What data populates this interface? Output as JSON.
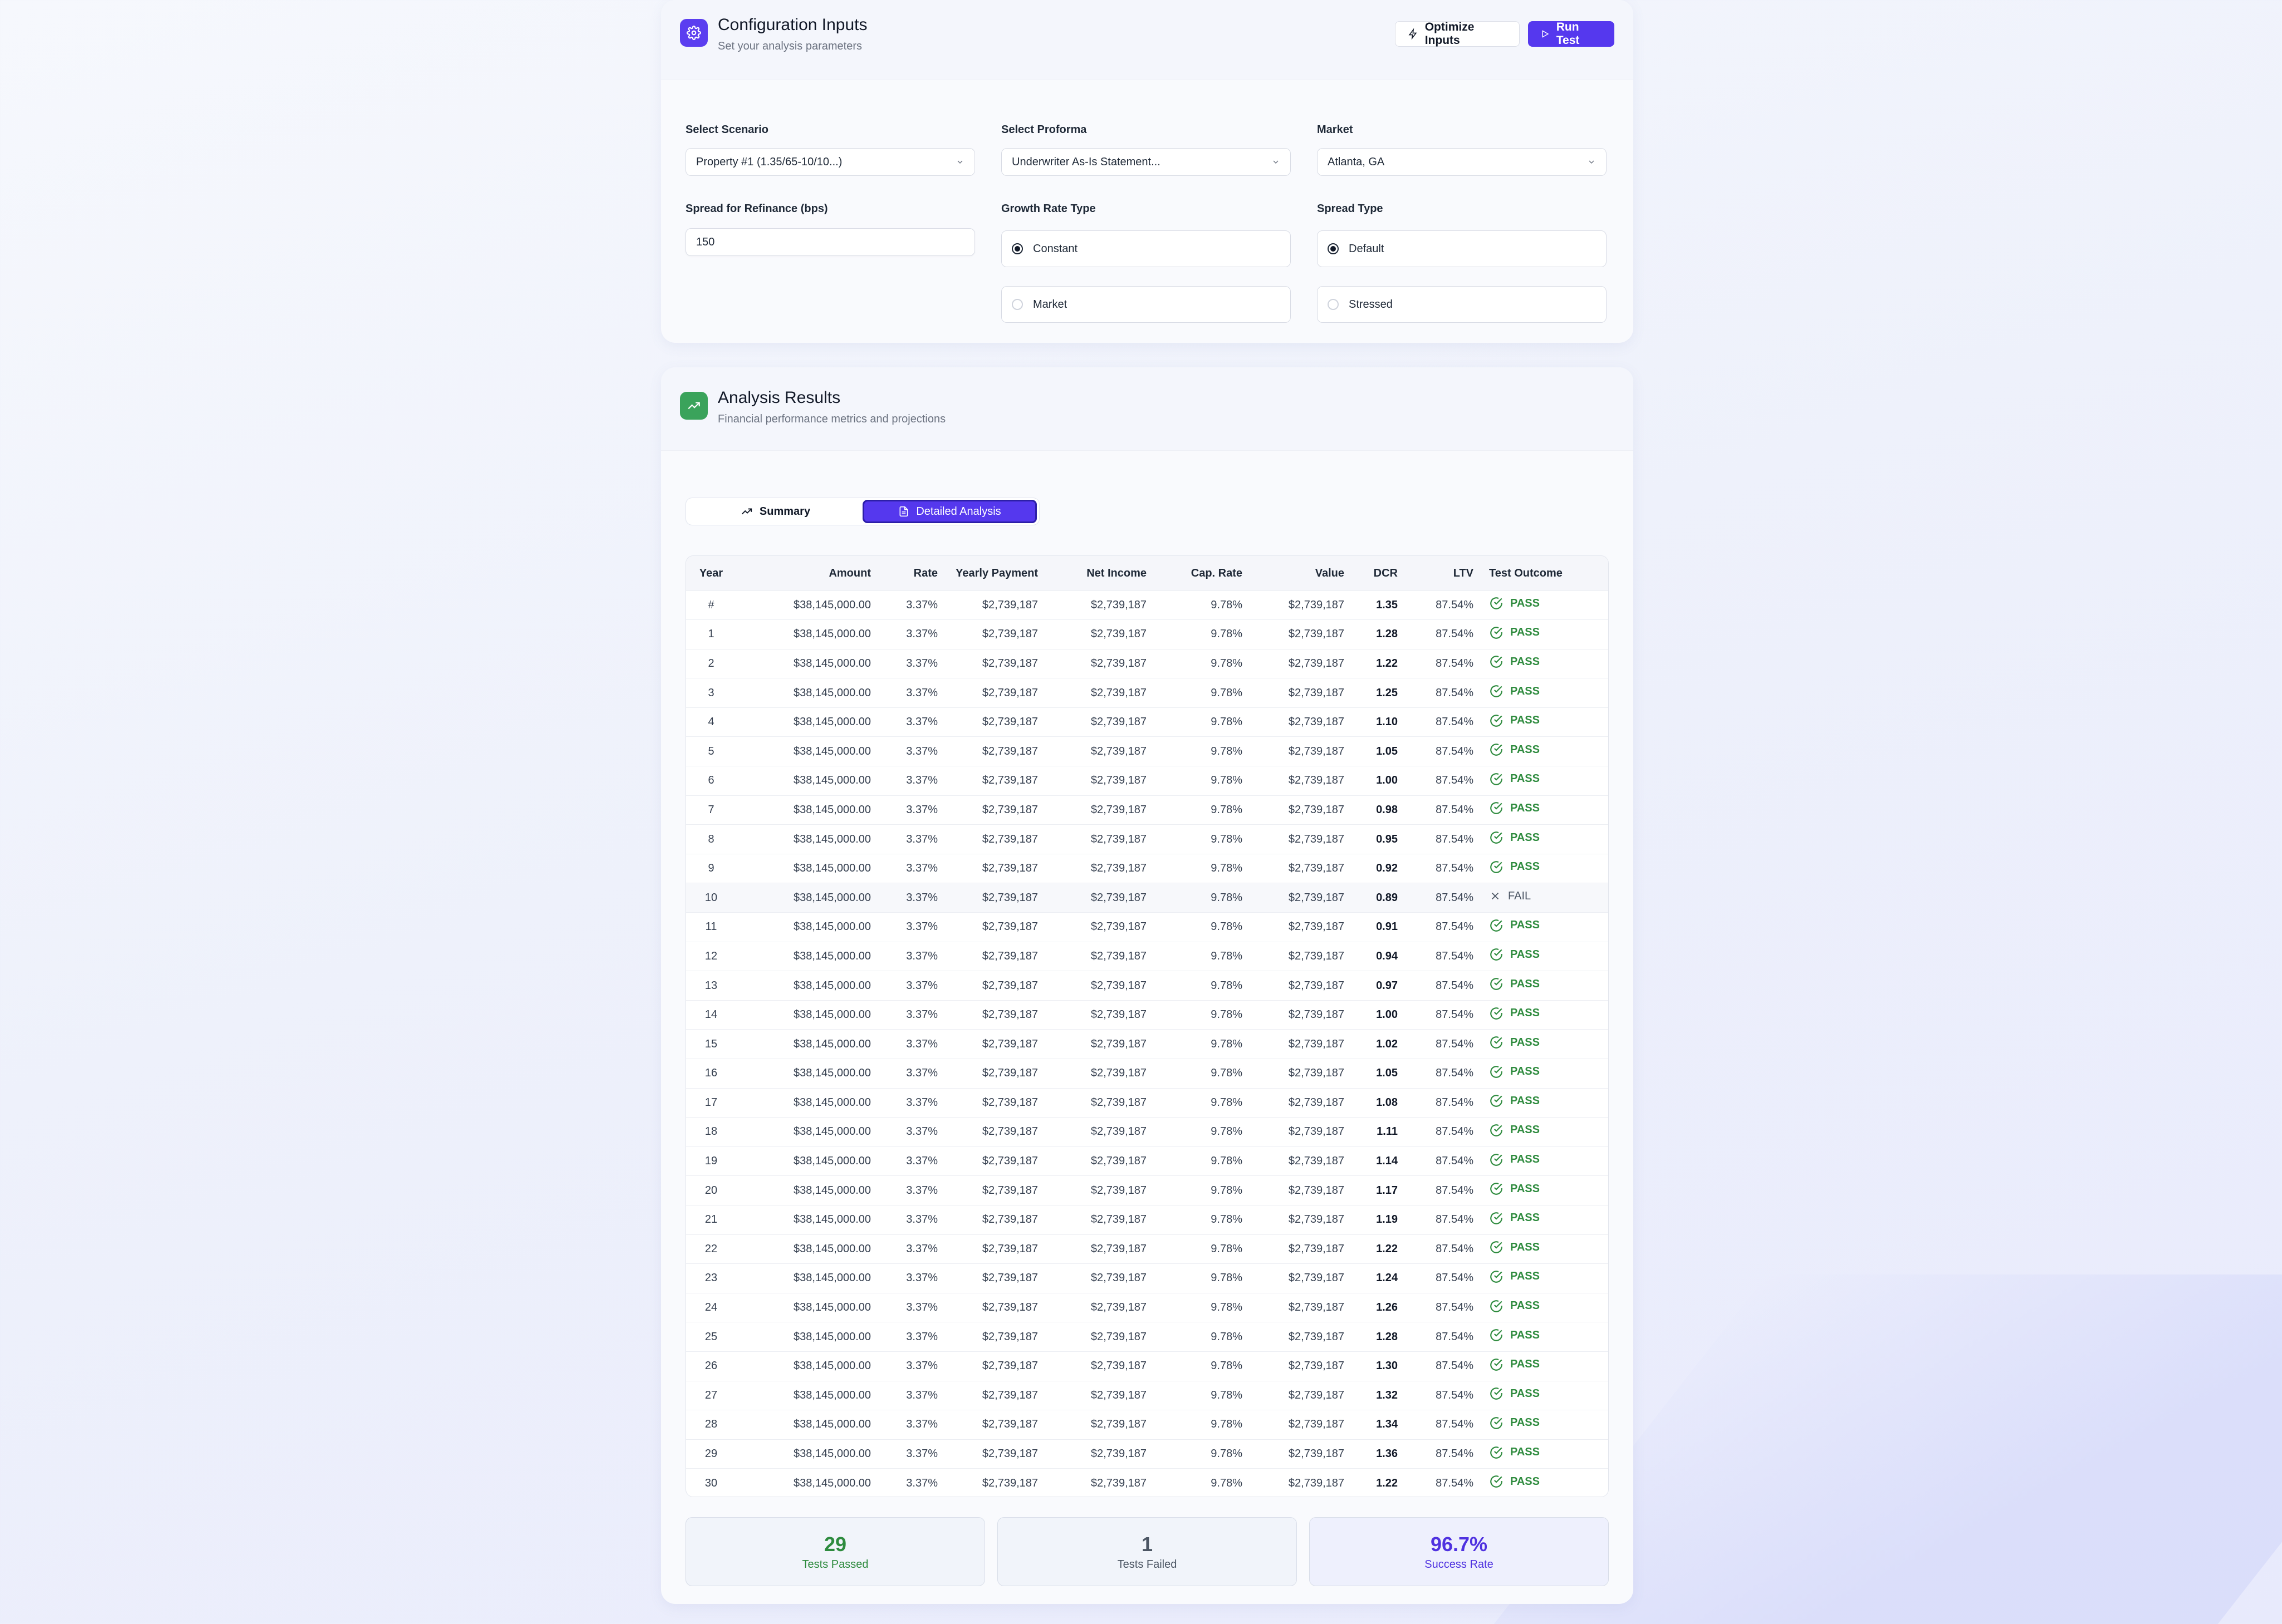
{
  "config": {
    "title": "Configuration Inputs",
    "subtitle": "Set your analysis parameters",
    "optimize_label": "Optimize Inputs",
    "run_label": "Run Test",
    "scenario": {
      "label": "Select Scenario",
      "value": "Property #1 (1.35/65-10/10...)"
    },
    "proforma": {
      "label": "Select Proforma",
      "value": "Underwriter As-Is Statement..."
    },
    "market": {
      "label": "Market",
      "value": "Atlanta, GA"
    },
    "spread": {
      "label": "Spread for Refinance (bps)",
      "value": "150"
    },
    "growth": {
      "label": "Growth Rate Type",
      "options": [
        "Constant",
        "Market"
      ],
      "selected": "Constant"
    },
    "spread_type": {
      "label": "Spread Type",
      "options": [
        "Default",
        "Stressed"
      ],
      "selected": "Default"
    }
  },
  "results": {
    "title": "Analysis Results",
    "subtitle": "Financial performance metrics and projections",
    "tabs": [
      "Summary",
      "Detailed Analysis"
    ],
    "active_tab": "Detailed Analysis",
    "columns": [
      "Year",
      "Amount",
      "Rate",
      "Yearly Payment",
      "Net Income",
      "Cap. Rate",
      "Value",
      "DCR",
      "LTV",
      "Test Outcome"
    ],
    "rows": [
      {
        "year": "#",
        "amount": "$38,145,000.00",
        "rate": "3.37%",
        "payment": "$2,739,187",
        "net": "$2,739,187",
        "cap": "9.78%",
        "value": "$2,739,187",
        "dcr": "1.35",
        "ltv": "87.54%",
        "outcome": "PASS"
      },
      {
        "year": "1",
        "amount": "$38,145,000.00",
        "rate": "3.37%",
        "payment": "$2,739,187",
        "net": "$2,739,187",
        "cap": "9.78%",
        "value": "$2,739,187",
        "dcr": "1.28",
        "ltv": "87.54%",
        "outcome": "PASS"
      },
      {
        "year": "2",
        "amount": "$38,145,000.00",
        "rate": "3.37%",
        "payment": "$2,739,187",
        "net": "$2,739,187",
        "cap": "9.78%",
        "value": "$2,739,187",
        "dcr": "1.22",
        "ltv": "87.54%",
        "outcome": "PASS"
      },
      {
        "year": "3",
        "amount": "$38,145,000.00",
        "rate": "3.37%",
        "payment": "$2,739,187",
        "net": "$2,739,187",
        "cap": "9.78%",
        "value": "$2,739,187",
        "dcr": "1.25",
        "ltv": "87.54%",
        "outcome": "PASS"
      },
      {
        "year": "4",
        "amount": "$38,145,000.00",
        "rate": "3.37%",
        "payment": "$2,739,187",
        "net": "$2,739,187",
        "cap": "9.78%",
        "value": "$2,739,187",
        "dcr": "1.10",
        "ltv": "87.54%",
        "outcome": "PASS"
      },
      {
        "year": "5",
        "amount": "$38,145,000.00",
        "rate": "3.37%",
        "payment": "$2,739,187",
        "net": "$2,739,187",
        "cap": "9.78%",
        "value": "$2,739,187",
        "dcr": "1.05",
        "ltv": "87.54%",
        "outcome": "PASS"
      },
      {
        "year": "6",
        "amount": "$38,145,000.00",
        "rate": "3.37%",
        "payment": "$2,739,187",
        "net": "$2,739,187",
        "cap": "9.78%",
        "value": "$2,739,187",
        "dcr": "1.00",
        "ltv": "87.54%",
        "outcome": "PASS"
      },
      {
        "year": "7",
        "amount": "$38,145,000.00",
        "rate": "3.37%",
        "payment": "$2,739,187",
        "net": "$2,739,187",
        "cap": "9.78%",
        "value": "$2,739,187",
        "dcr": "0.98",
        "ltv": "87.54%",
        "outcome": "PASS"
      },
      {
        "year": "8",
        "amount": "$38,145,000.00",
        "rate": "3.37%",
        "payment": "$2,739,187",
        "net": "$2,739,187",
        "cap": "9.78%",
        "value": "$2,739,187",
        "dcr": "0.95",
        "ltv": "87.54%",
        "outcome": "PASS"
      },
      {
        "year": "9",
        "amount": "$38,145,000.00",
        "rate": "3.37%",
        "payment": "$2,739,187",
        "net": "$2,739,187",
        "cap": "9.78%",
        "value": "$2,739,187",
        "dcr": "0.92",
        "ltv": "87.54%",
        "outcome": "PASS"
      },
      {
        "year": "10",
        "amount": "$38,145,000.00",
        "rate": "3.37%",
        "payment": "$2,739,187",
        "net": "$2,739,187",
        "cap": "9.78%",
        "value": "$2,739,187",
        "dcr": "0.89",
        "ltv": "87.54%",
        "outcome": "FAIL"
      },
      {
        "year": "11",
        "amount": "$38,145,000.00",
        "rate": "3.37%",
        "payment": "$2,739,187",
        "net": "$2,739,187",
        "cap": "9.78%",
        "value": "$2,739,187",
        "dcr": "0.91",
        "ltv": "87.54%",
        "outcome": "PASS"
      },
      {
        "year": "12",
        "amount": "$38,145,000.00",
        "rate": "3.37%",
        "payment": "$2,739,187",
        "net": "$2,739,187",
        "cap": "9.78%",
        "value": "$2,739,187",
        "dcr": "0.94",
        "ltv": "87.54%",
        "outcome": "PASS"
      },
      {
        "year": "13",
        "amount": "$38,145,000.00",
        "rate": "3.37%",
        "payment": "$2,739,187",
        "net": "$2,739,187",
        "cap": "9.78%",
        "value": "$2,739,187",
        "dcr": "0.97",
        "ltv": "87.54%",
        "outcome": "PASS"
      },
      {
        "year": "14",
        "amount": "$38,145,000.00",
        "rate": "3.37%",
        "payment": "$2,739,187",
        "net": "$2,739,187",
        "cap": "9.78%",
        "value": "$2,739,187",
        "dcr": "1.00",
        "ltv": "87.54%",
        "outcome": "PASS"
      },
      {
        "year": "15",
        "amount": "$38,145,000.00",
        "rate": "3.37%",
        "payment": "$2,739,187",
        "net": "$2,739,187",
        "cap": "9.78%",
        "value": "$2,739,187",
        "dcr": "1.02",
        "ltv": "87.54%",
        "outcome": "PASS"
      },
      {
        "year": "16",
        "amount": "$38,145,000.00",
        "rate": "3.37%",
        "payment": "$2,739,187",
        "net": "$2,739,187",
        "cap": "9.78%",
        "value": "$2,739,187",
        "dcr": "1.05",
        "ltv": "87.54%",
        "outcome": "PASS"
      },
      {
        "year": "17",
        "amount": "$38,145,000.00",
        "rate": "3.37%",
        "payment": "$2,739,187",
        "net": "$2,739,187",
        "cap": "9.78%",
        "value": "$2,739,187",
        "dcr": "1.08",
        "ltv": "87.54%",
        "outcome": "PASS"
      },
      {
        "year": "18",
        "amount": "$38,145,000.00",
        "rate": "3.37%",
        "payment": "$2,739,187",
        "net": "$2,739,187",
        "cap": "9.78%",
        "value": "$2,739,187",
        "dcr": "1.11",
        "ltv": "87.54%",
        "outcome": "PASS"
      },
      {
        "year": "19",
        "amount": "$38,145,000.00",
        "rate": "3.37%",
        "payment": "$2,739,187",
        "net": "$2,739,187",
        "cap": "9.78%",
        "value": "$2,739,187",
        "dcr": "1.14",
        "ltv": "87.54%",
        "outcome": "PASS"
      },
      {
        "year": "20",
        "amount": "$38,145,000.00",
        "rate": "3.37%",
        "payment": "$2,739,187",
        "net": "$2,739,187",
        "cap": "9.78%",
        "value": "$2,739,187",
        "dcr": "1.17",
        "ltv": "87.54%",
        "outcome": "PASS"
      },
      {
        "year": "21",
        "amount": "$38,145,000.00",
        "rate": "3.37%",
        "payment": "$2,739,187",
        "net": "$2,739,187",
        "cap": "9.78%",
        "value": "$2,739,187",
        "dcr": "1.19",
        "ltv": "87.54%",
        "outcome": "PASS"
      },
      {
        "year": "22",
        "amount": "$38,145,000.00",
        "rate": "3.37%",
        "payment": "$2,739,187",
        "net": "$2,739,187",
        "cap": "9.78%",
        "value": "$2,739,187",
        "dcr": "1.22",
        "ltv": "87.54%",
        "outcome": "PASS"
      },
      {
        "year": "23",
        "amount": "$38,145,000.00",
        "rate": "3.37%",
        "payment": "$2,739,187",
        "net": "$2,739,187",
        "cap": "9.78%",
        "value": "$2,739,187",
        "dcr": "1.24",
        "ltv": "87.54%",
        "outcome": "PASS"
      },
      {
        "year": "24",
        "amount": "$38,145,000.00",
        "rate": "3.37%",
        "payment": "$2,739,187",
        "net": "$2,739,187",
        "cap": "9.78%",
        "value": "$2,739,187",
        "dcr": "1.26",
        "ltv": "87.54%",
        "outcome": "PASS"
      },
      {
        "year": "25",
        "amount": "$38,145,000.00",
        "rate": "3.37%",
        "payment": "$2,739,187",
        "net": "$2,739,187",
        "cap": "9.78%",
        "value": "$2,739,187",
        "dcr": "1.28",
        "ltv": "87.54%",
        "outcome": "PASS"
      },
      {
        "year": "26",
        "amount": "$38,145,000.00",
        "rate": "3.37%",
        "payment": "$2,739,187",
        "net": "$2,739,187",
        "cap": "9.78%",
        "value": "$2,739,187",
        "dcr": "1.30",
        "ltv": "87.54%",
        "outcome": "PASS"
      },
      {
        "year": "27",
        "amount": "$38,145,000.00",
        "rate": "3.37%",
        "payment": "$2,739,187",
        "net": "$2,739,187",
        "cap": "9.78%",
        "value": "$2,739,187",
        "dcr": "1.32",
        "ltv": "87.54%",
        "outcome": "PASS"
      },
      {
        "year": "28",
        "amount": "$38,145,000.00",
        "rate": "3.37%",
        "payment": "$2,739,187",
        "net": "$2,739,187",
        "cap": "9.78%",
        "value": "$2,739,187",
        "dcr": "1.34",
        "ltv": "87.54%",
        "outcome": "PASS"
      },
      {
        "year": "29",
        "amount": "$38,145,000.00",
        "rate": "3.37%",
        "payment": "$2,739,187",
        "net": "$2,739,187",
        "cap": "9.78%",
        "value": "$2,739,187",
        "dcr": "1.36",
        "ltv": "87.54%",
        "outcome": "PASS"
      },
      {
        "year": "30",
        "amount": "$38,145,000.00",
        "rate": "3.37%",
        "payment": "$2,739,187",
        "net": "$2,739,187",
        "cap": "9.78%",
        "value": "$2,739,187",
        "dcr": "1.22",
        "ltv": "87.54%",
        "outcome": "PASS"
      }
    ],
    "stats": [
      {
        "value": "29",
        "label": "Tests Passed",
        "color": "#2e8b3e"
      },
      {
        "value": "1",
        "label": "Tests Failed",
        "color": "#4b5563"
      },
      {
        "value": "96.7%",
        "label": "Success Rate",
        "color": "#4f32e0"
      }
    ]
  },
  "icons": {
    "config": "gear-icon",
    "optimize": "lightning-icon",
    "run": "play-icon",
    "results": "trend-up-icon",
    "summary_tab": "trend-up-icon",
    "detailed_tab": "document-icon",
    "pass": "check-circle-icon",
    "fail": "x-icon"
  },
  "colors": {
    "accent": "#5538ee",
    "pass": "#2e8b3e",
    "results_icon_bg": "#3aa35b"
  }
}
